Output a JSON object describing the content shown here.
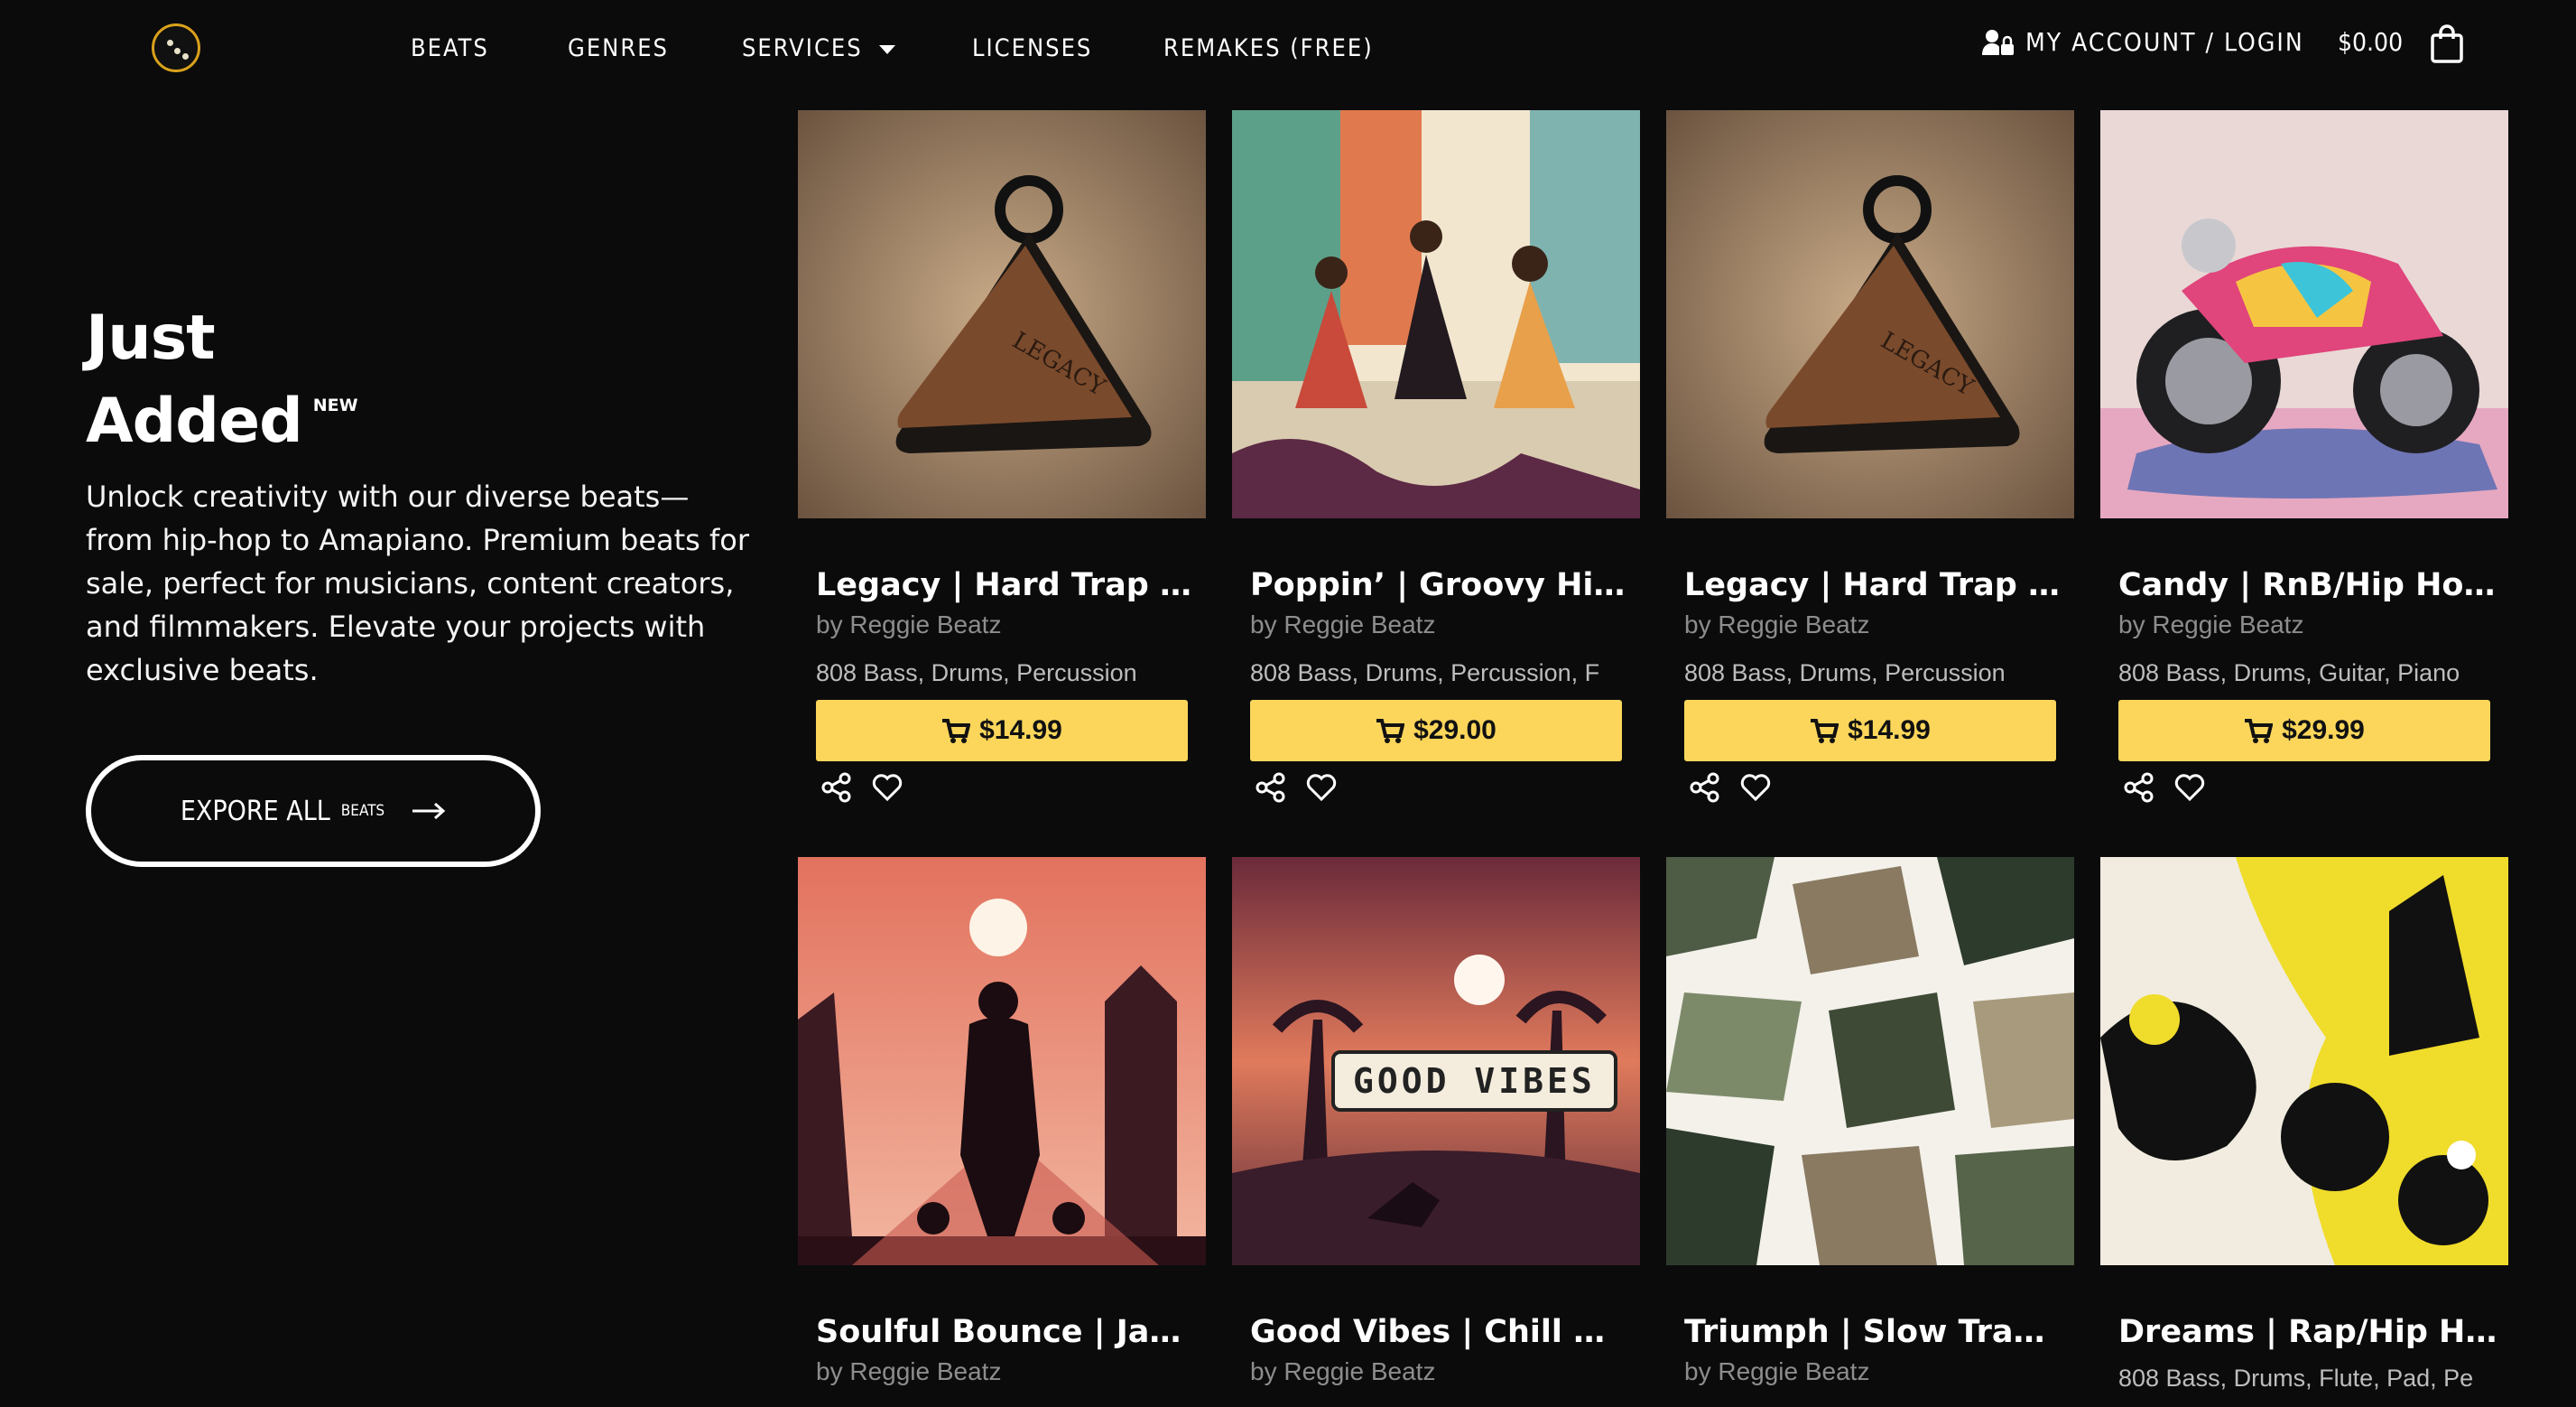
{
  "nav": {
    "items": [
      "BEATS",
      "GENRES",
      "SERVICES",
      "LICENSES",
      "REMAKES (FREE)"
    ],
    "account_label": "MY ACCOUNT / LOGIN",
    "cart_total": "$0.00"
  },
  "hero": {
    "title_line1": "Just",
    "title_line2": "Added",
    "badge": "NEW",
    "description": "Unlock creativity with our diverse beats—from hip-hop to Amapiano. Premium beats for sale, perfect for musicians, content creators, and filmmakers. Elevate your projects with exclusive beats.",
    "cta_label": "EXPORE ALL",
    "cta_sup": "BEATS"
  },
  "beats": [
    {
      "title": "Legacy | Hard Trap B...",
      "artist": "by Reggie Beatz",
      "tags": "808 Bass, Drums, Percussion",
      "price": "$14.99"
    },
    {
      "title": "Poppin’ | Groovy Hip ...",
      "artist": "by Reggie Beatz",
      "tags": "808 Bass, Drums, Percussion, F",
      "price": "$29.00"
    },
    {
      "title": "Legacy | Hard Trap B...",
      "artist": "by Reggie Beatz",
      "tags": "808 Bass, Drums, Percussion",
      "price": "$14.99"
    },
    {
      "title": "Candy | RnB/Hip Hop ...",
      "artist": "by Reggie Beatz",
      "tags": "808 Bass, Drums, Guitar, Piano",
      "price": "$29.99"
    },
    {
      "title": "Soulful Bounce | Jazz...",
      "artist": "by Reggie Beatz"
    },
    {
      "title": "Good Vibes | Chill Hip...",
      "artist": "by Reggie Beatz",
      "cover_text": "GOOD VIBES"
    },
    {
      "title": "Triumph | Slow Trap I...",
      "artist": "by Reggie Beatz"
    },
    {
      "title": "Dreams | Rap/Hip Ho...",
      "tags": "808 Bass, Drums, Flute, Pad, Pe"
    }
  ],
  "colors": {
    "background": "#0b0b0c",
    "buy_button": "#fbd65b",
    "logo_ring": "#d9a21b"
  }
}
